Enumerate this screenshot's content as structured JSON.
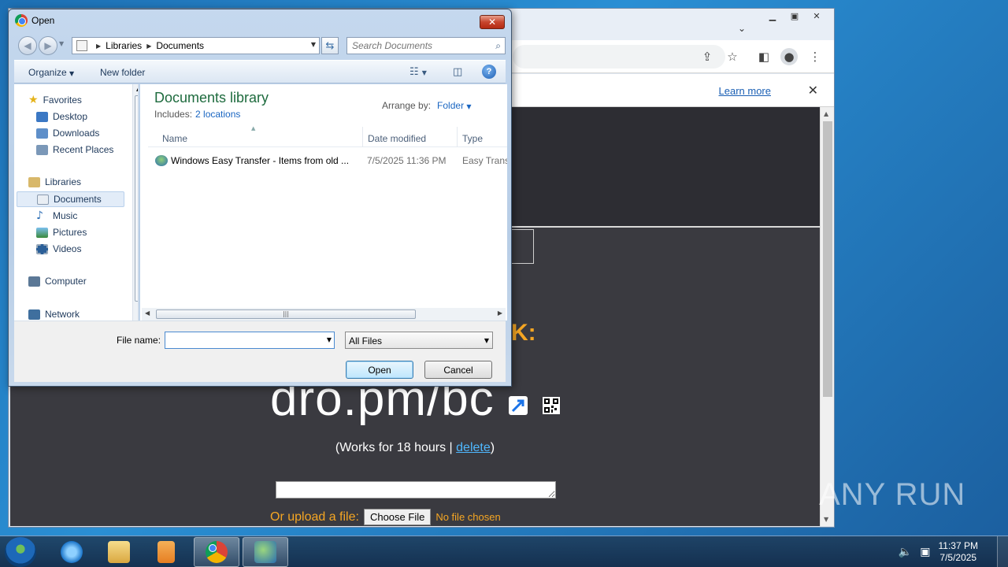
{
  "browser": {
    "infobar": {
      "learn_more": "Learn more"
    },
    "toolbar_icons": [
      "share-icon",
      "star-icon",
      "sidepanel-icon",
      "profile-icon",
      "menu-icon"
    ]
  },
  "page": {
    "short_url": "dro.pm/bc",
    "works_prefix": "(Works for 18 hours | ",
    "works_link": "delete",
    "works_suffix": ")",
    "upload_label": "Or upload a file:",
    "choose_file": "Choose File",
    "no_file": "No file chosen",
    "colon": "K:"
  },
  "dialog": {
    "title": "Open",
    "breadcrumb": [
      "Libraries",
      "Documents"
    ],
    "search_placeholder": "Search Documents",
    "organize": "Organize",
    "new_folder": "New folder",
    "nav": {
      "favorites": "Favorites",
      "favorites_items": [
        "Desktop",
        "Downloads",
        "Recent Places"
      ],
      "libraries": "Libraries",
      "libraries_items": [
        "Documents",
        "Music",
        "Pictures",
        "Videos"
      ],
      "computer": "Computer",
      "network": "Network"
    },
    "library_title": "Documents library",
    "includes_label": "Includes:",
    "includes_link": "2 locations",
    "arrange_label": "Arrange by:",
    "arrange_value": "Folder",
    "columns": [
      "Name",
      "Date modified",
      "Type"
    ],
    "files": [
      {
        "name": "Windows Easy Transfer - Items from old ...",
        "date": "7/5/2025 11:36 PM",
        "type": "Easy Transfe"
      }
    ],
    "filename_label": "File name:",
    "filename_value": "",
    "filetype": "All Files",
    "open_button": "Open",
    "cancel_button": "Cancel"
  },
  "taskbar": {
    "time": "11:37 PM",
    "date": "7/5/2025",
    "apps": [
      "internet-explorer",
      "file-explorer",
      "media-player",
      "chrome",
      "easy-transfer"
    ]
  },
  "watermark": "ANY RUN",
  "colors": {
    "accent": "#1a66c2",
    "page_bg": "#3a3a40",
    "orange": "#f5a623"
  }
}
